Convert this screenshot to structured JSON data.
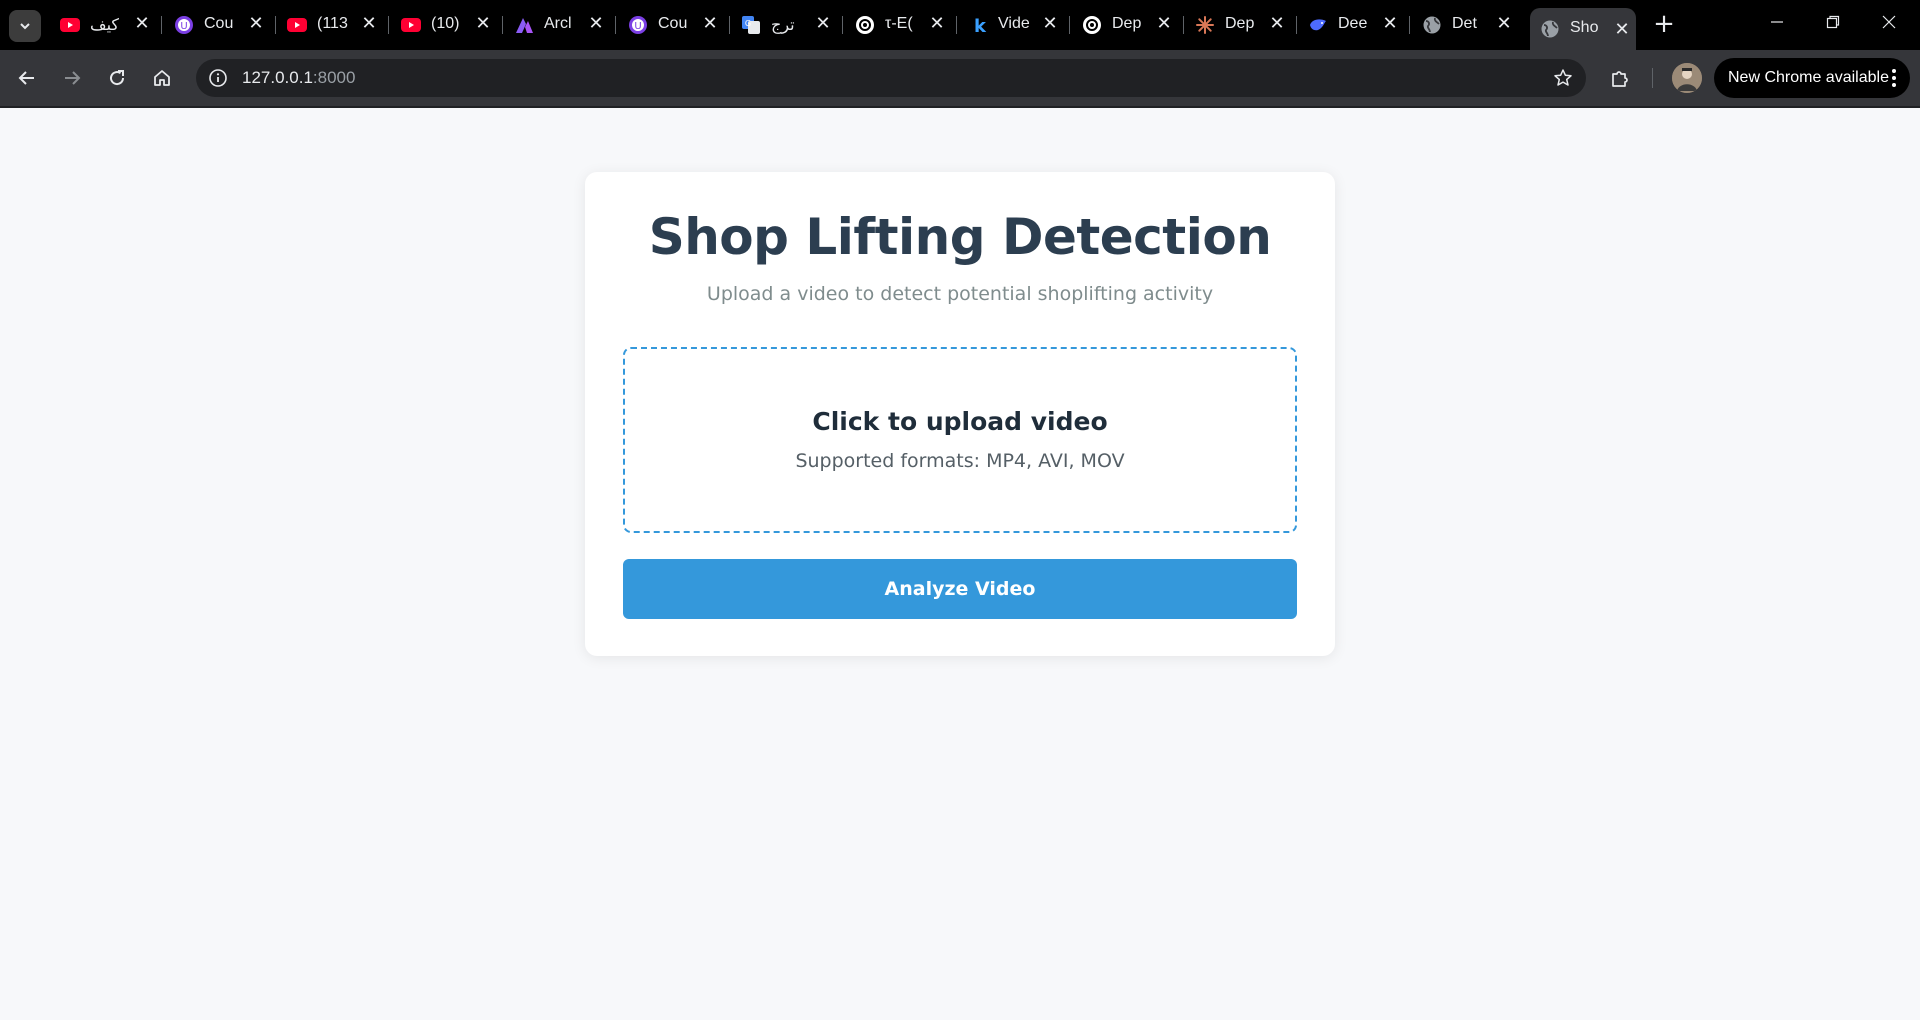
{
  "browser": {
    "tabs": [
      {
        "title": "كيف",
        "favicon": "youtube-icon",
        "active": false
      },
      {
        "title": "Cou",
        "favicon": "coursera-icon",
        "active": false
      },
      {
        "title": "(113",
        "favicon": "youtube-icon",
        "active": false
      },
      {
        "title": "(10)",
        "favicon": "youtube-icon",
        "active": false
      },
      {
        "title": "Arcl",
        "favicon": "arc-icon",
        "active": false
      },
      {
        "title": "Cou",
        "favicon": "coursera-icon",
        "active": false
      },
      {
        "title": "ترج",
        "favicon": "google-translate-icon",
        "active": false
      },
      {
        "title": "τ-E(",
        "favicon": "openai-icon",
        "active": false
      },
      {
        "title": "Vide",
        "favicon": "kling-icon",
        "active": false
      },
      {
        "title": "Dep",
        "favicon": "openai-icon",
        "active": false
      },
      {
        "title": "Dep",
        "favicon": "claude-icon",
        "active": false
      },
      {
        "title": "Dee",
        "favicon": "deepseek-icon",
        "active": false
      },
      {
        "title": "Det",
        "favicon": "globe-icon",
        "active": false
      },
      {
        "title": "Sho",
        "favicon": "globe-icon",
        "active": true
      }
    ],
    "close_glyph": "✕",
    "new_tab_glyph": "+",
    "address": {
      "host": "127.0.0.1",
      "port": ":8000"
    },
    "update_label": "New Chrome available",
    "colors": {
      "tabstrip": "#000000",
      "toolbar": "#35363a",
      "omnibox": "#202124"
    }
  },
  "page": {
    "title": "Shop Lifting Detection",
    "subtitle": "Upload a video to detect potential shoplifting activity",
    "upload": {
      "title": "Click to upload video",
      "formats": "Supported formats: MP4, AVI, MOV"
    },
    "analyze_button": "Analyze Video",
    "colors": {
      "accent": "#3498db",
      "heading": "#2c3e50",
      "background": "#f7f8fa"
    }
  }
}
